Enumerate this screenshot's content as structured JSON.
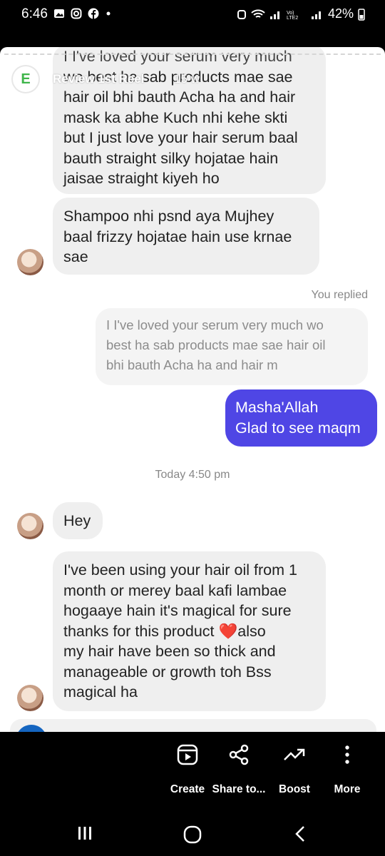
{
  "status_bar": {
    "time": "6:46",
    "notification_icons": [
      "gallery-icon",
      "instagram-icon",
      "facebook-icon",
      "dot-icon"
    ],
    "battery": "42%"
  },
  "story": {
    "avatar_letter": "E",
    "title": "Review 1st Reel",
    "time_partial": "15 w"
  },
  "messages": [
    {
      "type": "incoming",
      "lines": [
        "I I've loved your serum very much",
        "wo best ha sab products mae sae",
        "hair oil bhi bauth Acha ha and hair",
        "mask ka abhe Kuch nhi kehe skti",
        "but I just love your hair serum baal",
        "bauth straight silky hojatae hain",
        "jaisae straight kiyeh ho"
      ]
    },
    {
      "type": "incoming",
      "lines": [
        "Shampoo nhi psnd aya Mujhey",
        "baal frizzy hojatae hain use krnae",
        "sae"
      ]
    },
    {
      "type": "replied_label",
      "text": "You replied"
    },
    {
      "type": "reply_quote",
      "lines": [
        "I I've loved your serum very much wo",
        "best ha sab products mae sae hair oil",
        "bhi bauth Acha ha and hair m"
      ]
    },
    {
      "type": "outgoing",
      "lines": [
        "Masha'Allah",
        "Glad to see maqm"
      ]
    },
    {
      "type": "timestamp",
      "text": "Today 4:50 pm"
    },
    {
      "type": "incoming",
      "lines": [
        "Hey"
      ]
    },
    {
      "type": "incoming",
      "lines": [
        "I've been using your hair oil from 1",
        "month or merey baal kafi lambae",
        "hogaaye hain it's magical for sure",
        "thanks for this product ❤️also",
        "my hair have been so thick and",
        "manageable or growth toh Bss",
        "magical ha"
      ]
    }
  ],
  "actions": [
    {
      "label": "Create",
      "icon": "reel-create-icon"
    },
    {
      "label": "Share to...",
      "icon": "share-icon"
    },
    {
      "label": "Boost",
      "icon": "boost-trend-icon"
    },
    {
      "label": "More",
      "icon": "more-vertical-icon"
    }
  ],
  "nav": [
    "recent-apps-icon",
    "home-icon",
    "back-icon"
  ],
  "colors": {
    "outgoing_bubble": "#4f46e5",
    "incoming_bubble": "#efefef",
    "brand_e": "#3fb54a"
  }
}
